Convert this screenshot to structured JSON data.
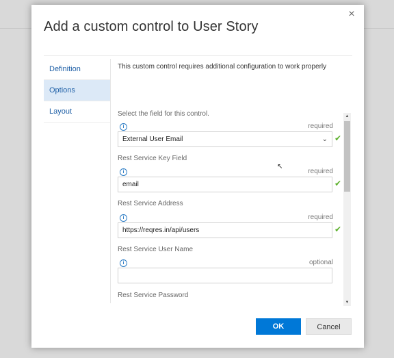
{
  "dialog": {
    "title": "Add a custom control to User Story",
    "close_glyph": "×"
  },
  "nav": {
    "items": [
      {
        "label": "Definition"
      },
      {
        "label": "Options"
      },
      {
        "label": "Layout"
      }
    ],
    "active_index": 1
  },
  "content": {
    "notice": "This custom control requires additional configuration to work properly",
    "fields": [
      {
        "label": "Select the field for this control.",
        "status": "required",
        "value": "External User Email",
        "kind": "select",
        "valid": true
      },
      {
        "label": "Rest Service Key Field",
        "status": "required",
        "value": "email",
        "kind": "text",
        "valid": true
      },
      {
        "label": "Rest Service Address",
        "status": "required",
        "value": "https://reqres.in/api/users",
        "kind": "text",
        "valid": true
      },
      {
        "label": "Rest Service User Name",
        "status": "optional",
        "value": "",
        "kind": "text",
        "valid": false
      },
      {
        "label": "Rest Service Password"
      }
    ]
  },
  "icons": {
    "info": "info-icon",
    "check": "check-icon",
    "check_color": "#5cb02c",
    "chevron": "chevron-down-icon"
  },
  "footer": {
    "ok_label": "OK",
    "cancel_label": "Cancel",
    "primary_color": "#0078d7"
  }
}
